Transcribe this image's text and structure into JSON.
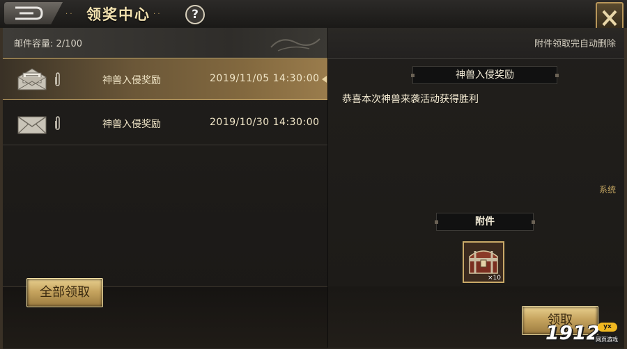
{
  "header": {
    "title": "领奖中心",
    "help_symbol": "?",
    "title_deco_left": "· ·",
    "title_deco_right": "· ·"
  },
  "mailbox": {
    "capacity_label": "邮件容量: ",
    "capacity_value": "2/100",
    "mails": [
      {
        "title": "神兽入侵奖励",
        "date": "2019/11/05  14:30:00",
        "selected": true,
        "opened": true
      },
      {
        "title": "神兽入侵奖励",
        "date": "2019/10/30  14:30:00",
        "selected": false,
        "opened": false
      }
    ],
    "claim_all_label": "全部领取"
  },
  "detail": {
    "auto_delete_note": "附件领取完自动删除",
    "subject": "神兽入侵奖励",
    "body": "恭喜本次神兽来袭活动获得胜利",
    "sender": "系统",
    "attachments_label": "附件",
    "attachment": {
      "icon": "treasure-chest-icon",
      "quantity": "×10"
    },
    "claim_label": "领取"
  },
  "watermark": {
    "text": "1912",
    "badge": "yx",
    "sub": "网页游戏"
  },
  "colors": {
    "gold": "#c6a45f",
    "selected_row": "#83693f",
    "text": "#f1e6c8"
  }
}
